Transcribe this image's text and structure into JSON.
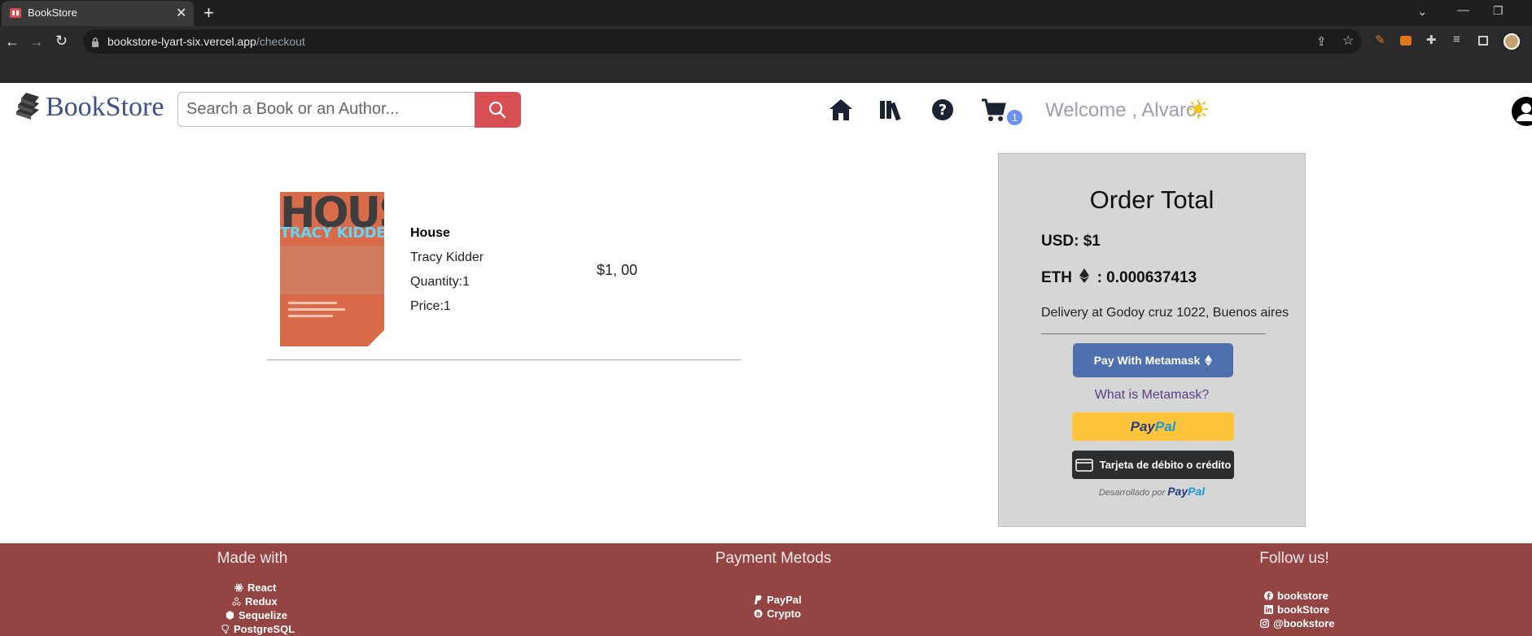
{
  "browser": {
    "tab_title": "BookStore",
    "url_host": "bookstore-lyart-six.vercel.app",
    "url_path": "/checkout"
  },
  "header": {
    "logo_text": "BookStore",
    "search_placeholder": "Search a Book or an Author...",
    "cart_count": "1",
    "welcome": "Welcome , Alvaro!"
  },
  "cart": {
    "items": [
      {
        "cover_title": "HOUSE",
        "cover_author": "TRACY KIDDER",
        "title": "House",
        "author": "Tracy Kidder",
        "quantity": "Quantity:1",
        "price": "Price:1",
        "total": "$1, 00"
      }
    ]
  },
  "order": {
    "title": "Order Total",
    "usd": "USD: $1",
    "eth_label": "ETH",
    "eth_value": ": 0.000637413",
    "delivery": "Delivery at Godoy cruz 1022, Buenos aires",
    "metamask_button": "Pay With Metamask",
    "what_is_metamask": "What is Metamask?",
    "paypal_button_a": "Pay",
    "paypal_button_b": "Pal",
    "card_button": "Tarjeta de débito o crédito",
    "powered_prefix": "Desarrollado por",
    "powered_brand_a": "Pay",
    "powered_brand_b": "Pal"
  },
  "footer": {
    "made_with": {
      "title": "Made with",
      "items": [
        "React",
        "Redux",
        "Sequelize",
        "PostgreSQL"
      ]
    },
    "payment": {
      "title": "Payment Metods",
      "items": [
        "PayPal",
        "Crypto"
      ]
    },
    "follow": {
      "title": "Follow us!",
      "items": [
        "bookstore",
        "bookStore",
        "@bookstore"
      ]
    }
  },
  "colors": {
    "accent_red": "#d94e53",
    "brand_blue": "#3a4f8c",
    "footer_bg": "#934443",
    "metamask_blue": "#4d6fae",
    "paypal_yellow": "#ffc43a"
  },
  "icons": [
    "book-stack-icon",
    "search-icon",
    "home-icon",
    "library-icon",
    "help-icon",
    "cart-icon",
    "sun-icon",
    "user-icon",
    "ethereum-icon",
    "card-icon",
    "react-icon",
    "redux-icon",
    "sequelize-icon",
    "postgresql-icon",
    "paypal-icon",
    "bitcoin-icon",
    "facebook-icon",
    "linkedin-icon",
    "instagram-icon"
  ]
}
